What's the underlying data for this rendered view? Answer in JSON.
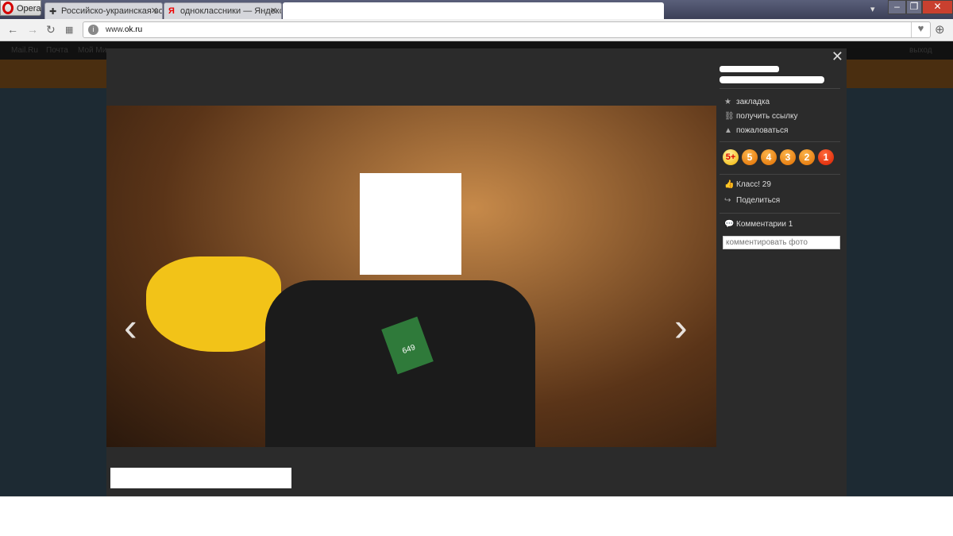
{
  "browser": {
    "menu_label": "Opera",
    "tabs": [
      {
        "label": "Российско-украинская во",
        "icon": "plus-icon"
      },
      {
        "label": "одноклассники — Яндекс",
        "icon": "yandex-icon"
      }
    ],
    "url_prefix": "www.",
    "url_domain": "ok.ru"
  },
  "page_nav": [
    "Mail.Ru",
    "Почта",
    "Мой Ми"
  ],
  "logout_label": "выход",
  "photo_viewer": {
    "actions": [
      "закладка",
      "получить ссылку",
      "пожаловаться"
    ],
    "ratings": [
      "5+",
      "5",
      "4",
      "3",
      "2",
      "1"
    ],
    "class_label": "Класс! 29",
    "share_label": "Поделиться",
    "comments_label": "Комментарии 1",
    "comment_placeholder": "комментировать фото",
    "tag_price": "649"
  }
}
